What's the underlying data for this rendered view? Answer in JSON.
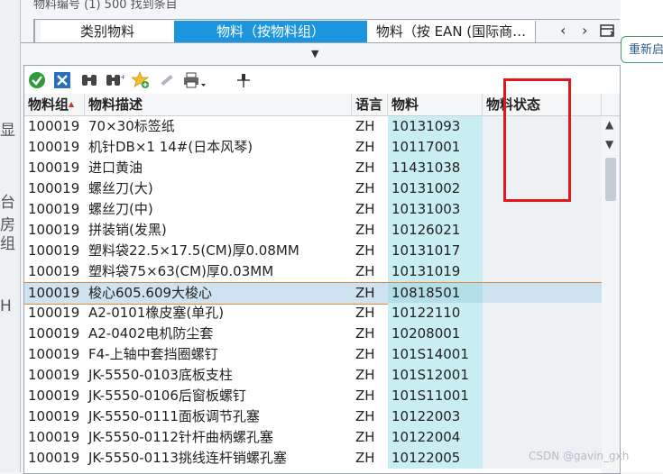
{
  "window": {
    "title": "物料编号 (1)   500 找到条目"
  },
  "background": {
    "left_ghost": [
      "显",
      "台房",
      "组",
      "H"
    ],
    "restart_button": "重新启"
  },
  "tabs": [
    {
      "label": "类别物料",
      "active": false
    },
    {
      "label": "物料（按物料组）",
      "active": true
    },
    {
      "label": "物料（按 EAN (国际商…",
      "active": false
    }
  ],
  "nav": {
    "prev": "‹",
    "next": "›"
  },
  "splitter_glyph": "▼",
  "columns": {
    "group": "物料组",
    "desc": "物料描述",
    "lang": "语言",
    "material": "物料",
    "status": "物料状态"
  },
  "rows": [
    {
      "group": "100019",
      "desc": "70×30标签纸",
      "lang": "ZH",
      "material": "10131093",
      "status": ""
    },
    {
      "group": "100019",
      "desc": "机针DB×1 14#(日本风琴)",
      "lang": "ZH",
      "material": "10117001",
      "status": ""
    },
    {
      "group": "100019",
      "desc": "进口黄油",
      "lang": "ZH",
      "material": "11431038",
      "status": ""
    },
    {
      "group": "100019",
      "desc": "螺丝刀(大)",
      "lang": "ZH",
      "material": "10131002",
      "status": ""
    },
    {
      "group": "100019",
      "desc": "螺丝刀(中)",
      "lang": "ZH",
      "material": "10131003",
      "status": ""
    },
    {
      "group": "100019",
      "desc": "拼装销(发黑)",
      "lang": "ZH",
      "material": "10126021",
      "status": ""
    },
    {
      "group": "100019",
      "desc": "塑料袋22.5×17.5(CM)厚0.08MM",
      "lang": "ZH",
      "material": "10131017",
      "status": ""
    },
    {
      "group": "100019",
      "desc": "塑料袋75×63(CM)厚0.03MM",
      "lang": "ZH",
      "material": "10131019",
      "status": ""
    },
    {
      "group": "100019",
      "desc": "梭心605.609大梭心",
      "lang": "ZH",
      "material": "10818501",
      "status": ""
    },
    {
      "group": "100019",
      "desc": "A2-0101橡皮塞(单孔)",
      "lang": "ZH",
      "material": "10122110",
      "status": ""
    },
    {
      "group": "100019",
      "desc": "A2-0402电机防尘套",
      "lang": "ZH",
      "material": "10208001",
      "status": ""
    },
    {
      "group": "100019",
      "desc": "F4-上轴中套挡圈螺钉",
      "lang": "ZH",
      "material": "101S14001",
      "status": ""
    },
    {
      "group": "100019",
      "desc": "JK-5550-0103底板支柱",
      "lang": "ZH",
      "material": "101S12001",
      "status": ""
    },
    {
      "group": "100019",
      "desc": "JK-5550-0106后窗板螺钉",
      "lang": "ZH",
      "material": "101S11001",
      "status": ""
    },
    {
      "group": "100019",
      "desc": "JK-5550-0111面板调节孔塞",
      "lang": "ZH",
      "material": "10122003",
      "status": ""
    },
    {
      "group": "100019",
      "desc": "JK-5550-0112针杆曲柄螺孔塞",
      "lang": "ZH",
      "material": "10122004",
      "status": ""
    },
    {
      "group": "100019",
      "desc": "JK-5550-0113挑线连杆销螺孔塞",
      "lang": "ZH",
      "material": "10122005",
      "status": ""
    }
  ],
  "selected_row_index": 8,
  "watermark": "CSDN @gavin_gxh",
  "colors": {
    "active_tab": "#1b95dd",
    "material_column": "#c9eef1",
    "highlight_box": "#e0181c",
    "selected_row_border": "#e08a3b"
  }
}
